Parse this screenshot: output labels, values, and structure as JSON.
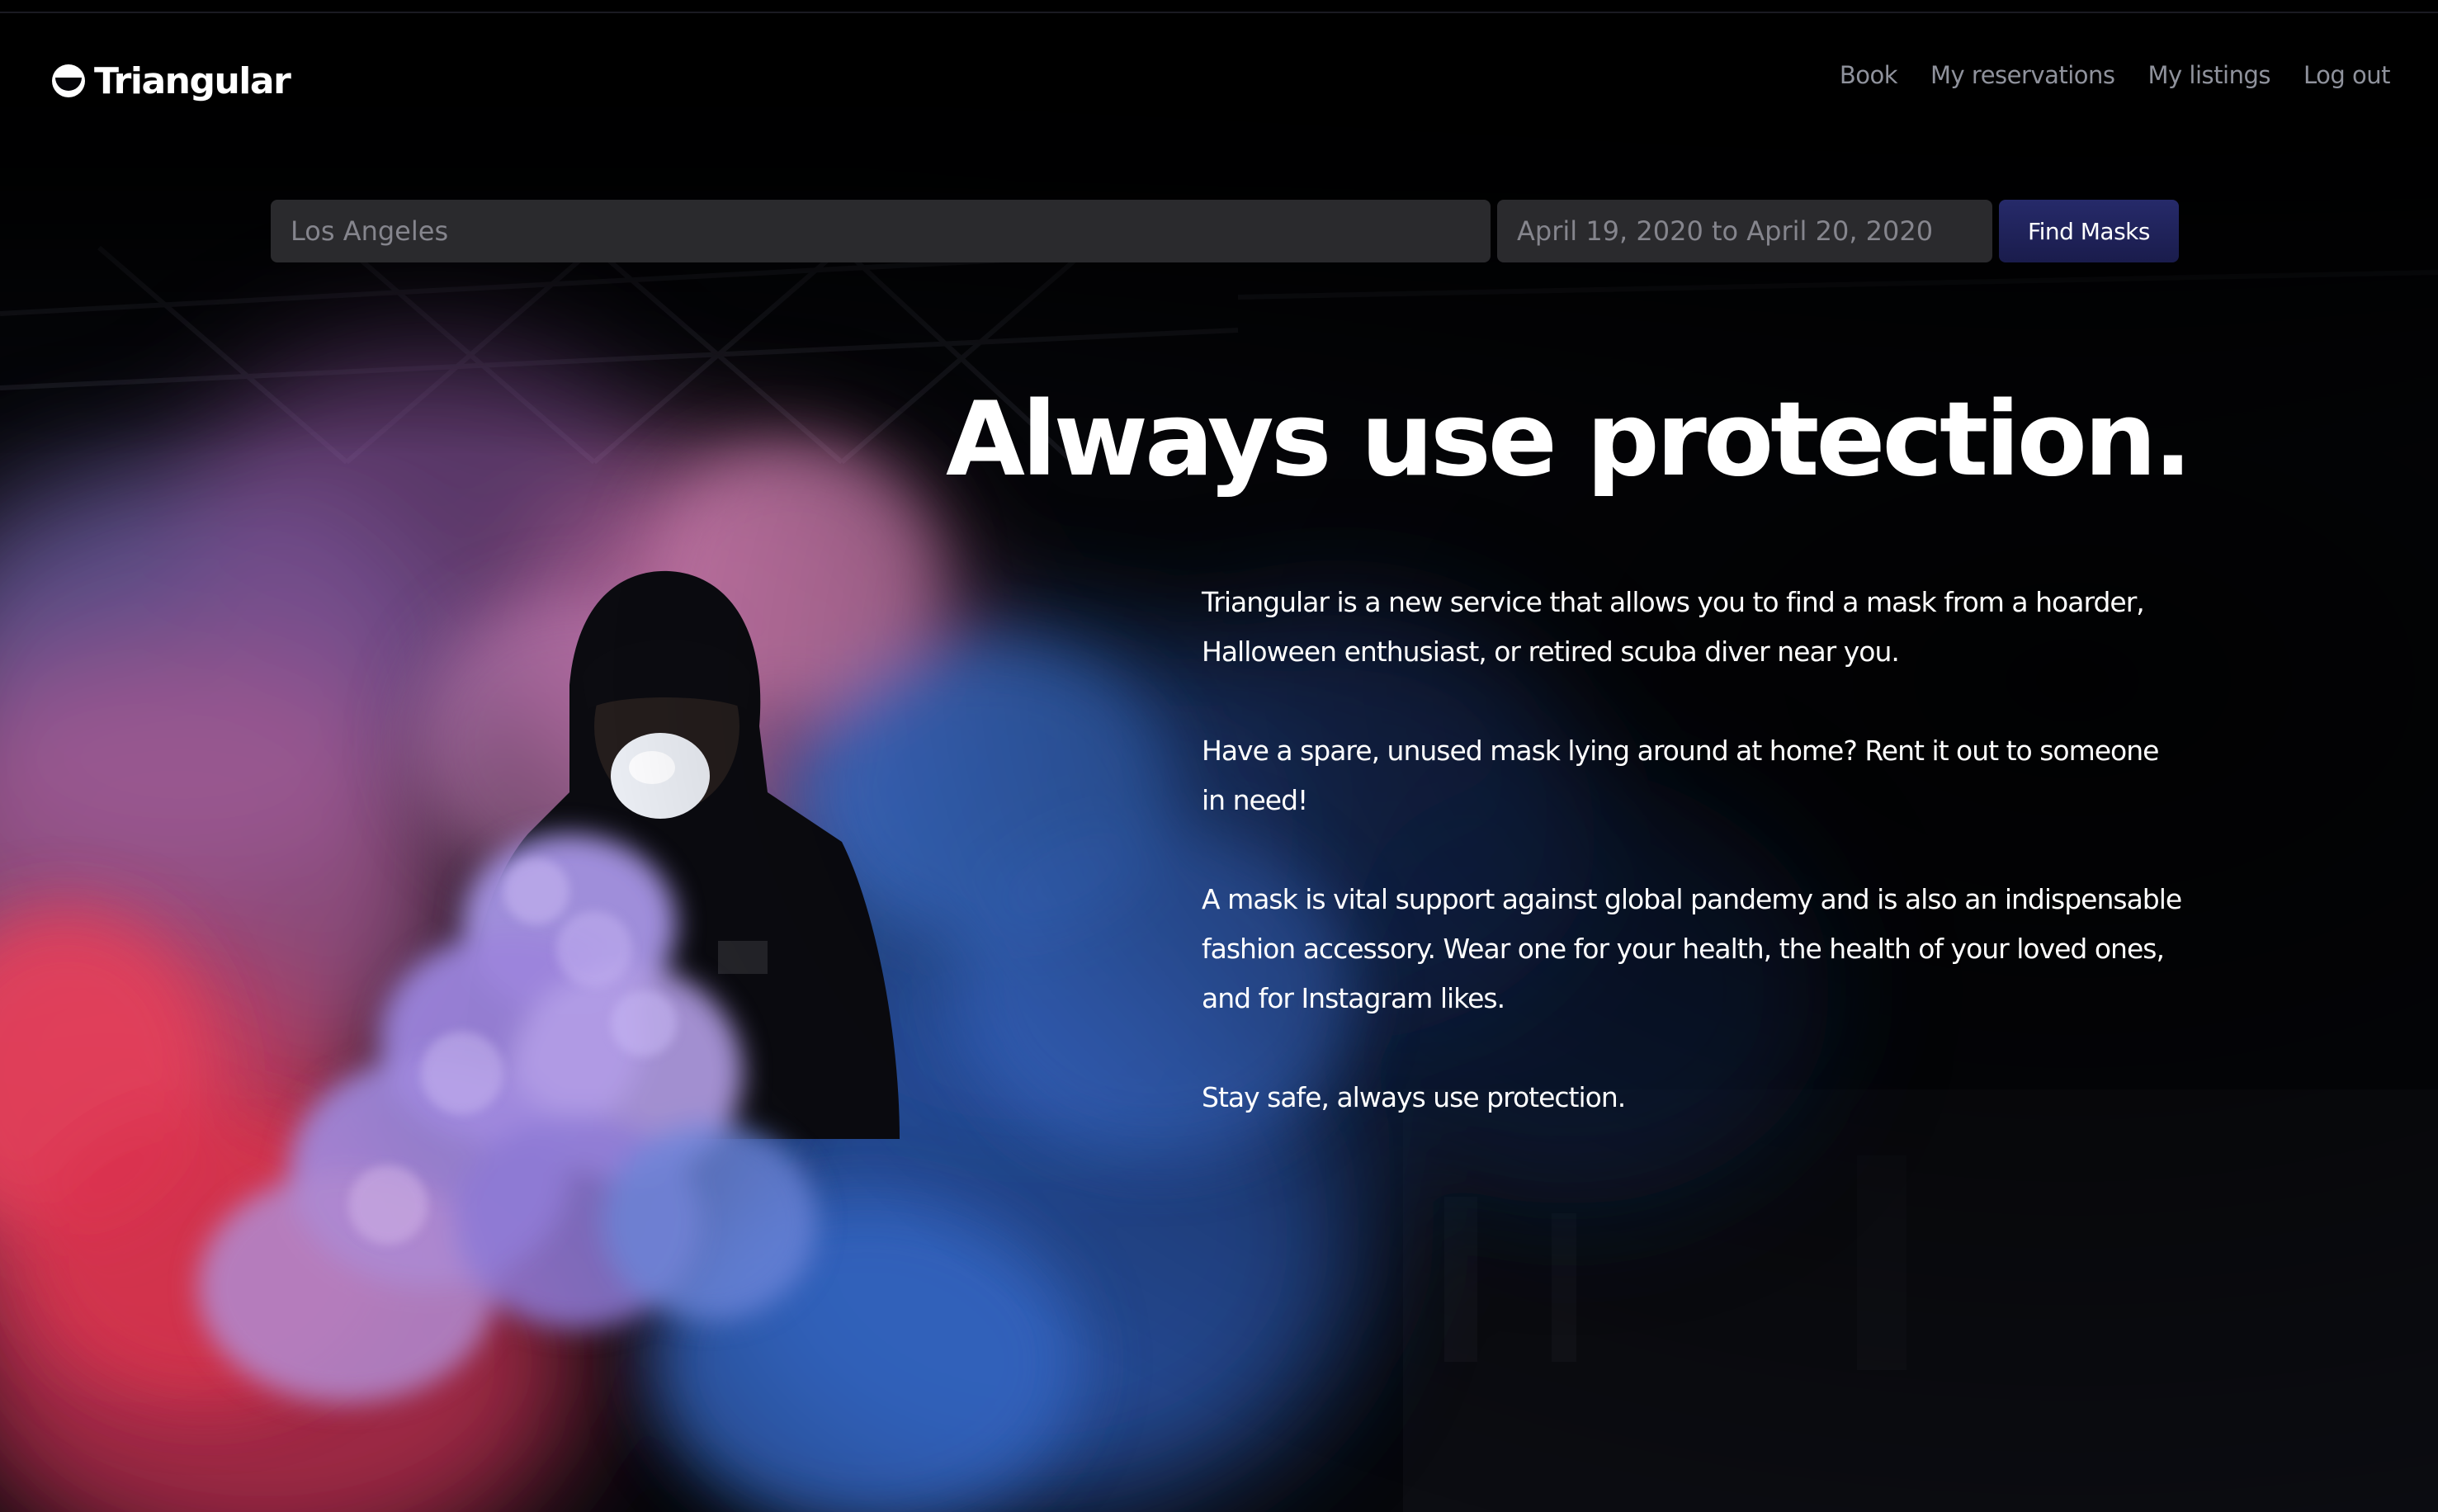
{
  "app": {
    "brand_name": "Triangular"
  },
  "nav": {
    "items": [
      {
        "label": "Book"
      },
      {
        "label": "My reservations"
      },
      {
        "label": "My listings"
      },
      {
        "label": "Log out"
      }
    ]
  },
  "search": {
    "location_placeholder": "Los Angeles",
    "dates_placeholder": "April 19, 2020 to April 20, 2020",
    "button_label": "Find Masks"
  },
  "hero": {
    "headline": "Always use protection.",
    "paragraphs": [
      "Triangular is a new service that allows you to find a mask from a hoarder, Halloween enthusiast, or retired scuba diver near you.",
      "Have a spare, unused mask lying around at home? Rent it out to someone in need!",
      "A mask is vital support against global pandemy and is also an indispensable fashion accessory. Wear one for your health, the health of your loved ones, and for Instagram likes.",
      "Stay safe, always use protection."
    ]
  },
  "icons": {
    "brand_mark": "half-moon-logo-icon"
  },
  "colors": {
    "background": "#050509",
    "nav_text": "#8f929c",
    "input_bg": "#2a2a2d",
    "button_bg": "#1f2260",
    "text": "#ffffff",
    "smoke_pink": "#e05c8c",
    "smoke_blue": "#3a6fd8",
    "smoke_red": "#e8344a",
    "smoke_lavender": "#a98ee0"
  }
}
